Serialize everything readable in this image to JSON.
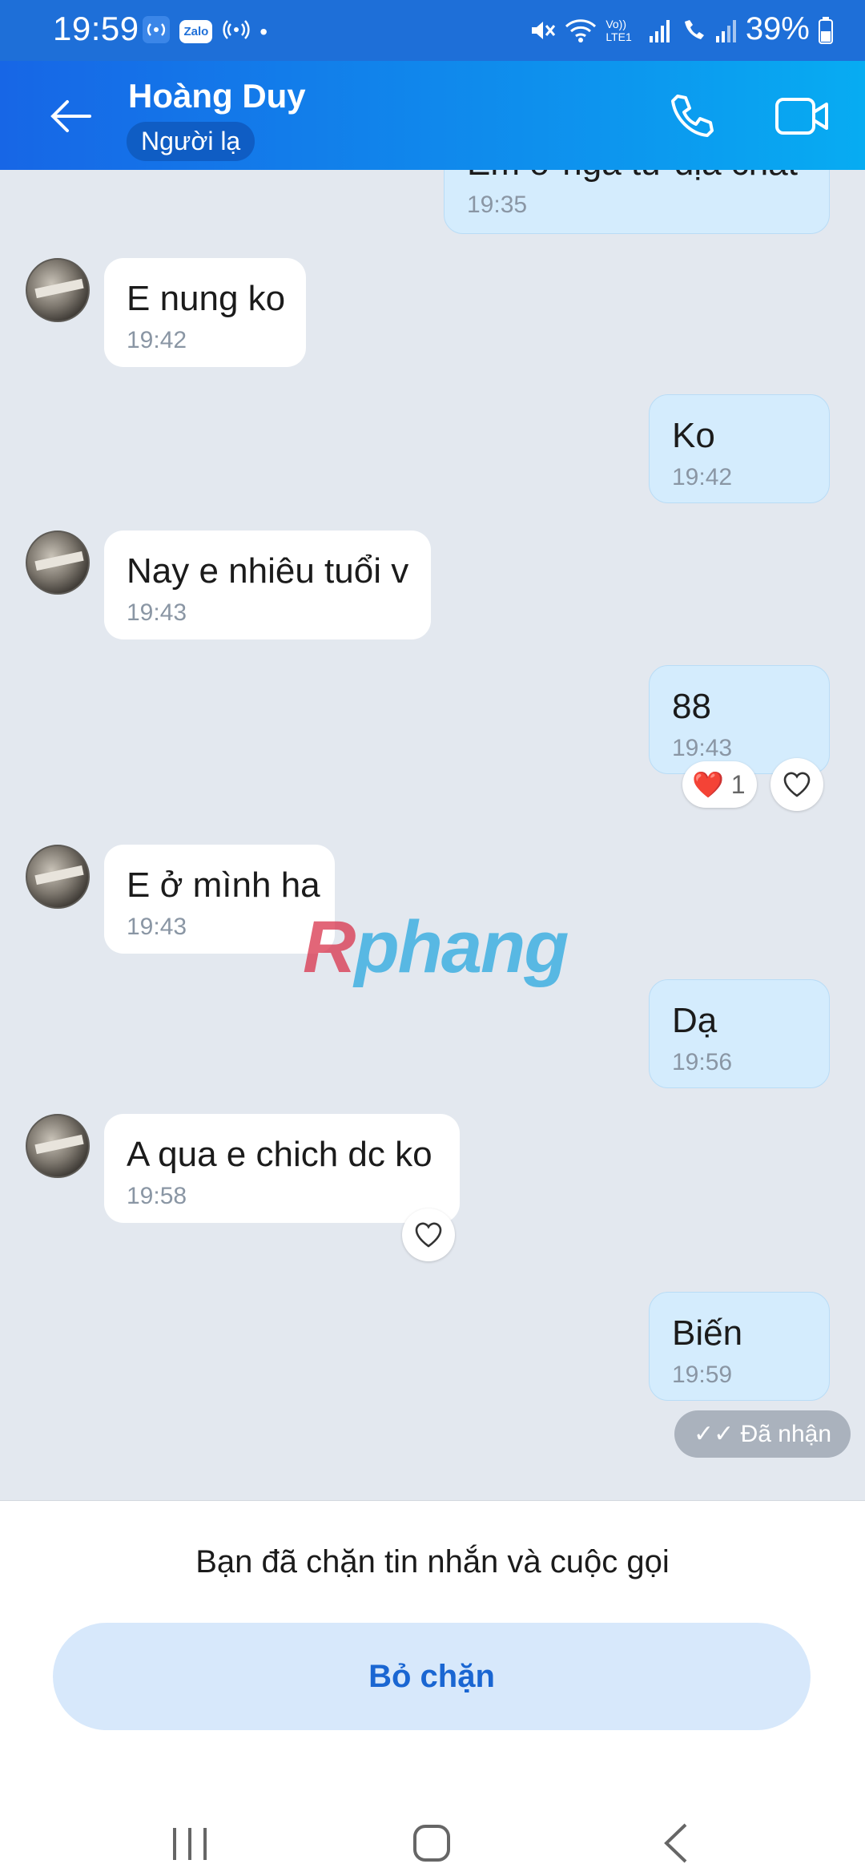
{
  "status_bar": {
    "time": "19:59",
    "zalo_chip": "Zalo",
    "dot": "•",
    "network_label": "Vo)) LTE1",
    "battery": "39%"
  },
  "header": {
    "contact_name": "Hoàng Duy",
    "tag": "Người lạ",
    "icons": [
      "back-arrow-icon",
      "phone-icon",
      "video-call-icon"
    ]
  },
  "chat": {
    "messages": [
      {
        "side": "out",
        "text": "Em ở ngã tư địa chất",
        "time": "19:35"
      },
      {
        "side": "in",
        "text": "E nung ko",
        "time": "19:42"
      },
      {
        "side": "out",
        "text": "Ko",
        "time": "19:42"
      },
      {
        "side": "in",
        "text": "Nay e nhiêu tuổi v",
        "time": "19:43"
      },
      {
        "side": "out",
        "text": "88",
        "time": "19:43",
        "reaction": "❤️",
        "reaction_count": "1"
      },
      {
        "side": "in",
        "text": "E ở mình ha",
        "time": "19:43"
      },
      {
        "side": "out",
        "text": "Dạ",
        "time": "19:56"
      },
      {
        "side": "in",
        "text": "A qua e chich dc ko",
        "time": "19:58"
      },
      {
        "side": "out",
        "text": "Biến",
        "time": "19:59"
      }
    ],
    "delivery_status": "Đã nhận",
    "watermark_part1": "R",
    "watermark_part2": "phang"
  },
  "bottom": {
    "blocked_note": "Bạn đã chặn tin nhắn và cuộc gọi",
    "unblock_label": "Bỏ chặn"
  },
  "colors": {
    "header_start": "#1766e6",
    "header_end": "#07acf2",
    "outgoing_bubble": "#d4ecfd",
    "incoming_bubble": "#ffffff",
    "chat_background": "#e3e8ef",
    "unblock_text": "#1a66d2"
  }
}
